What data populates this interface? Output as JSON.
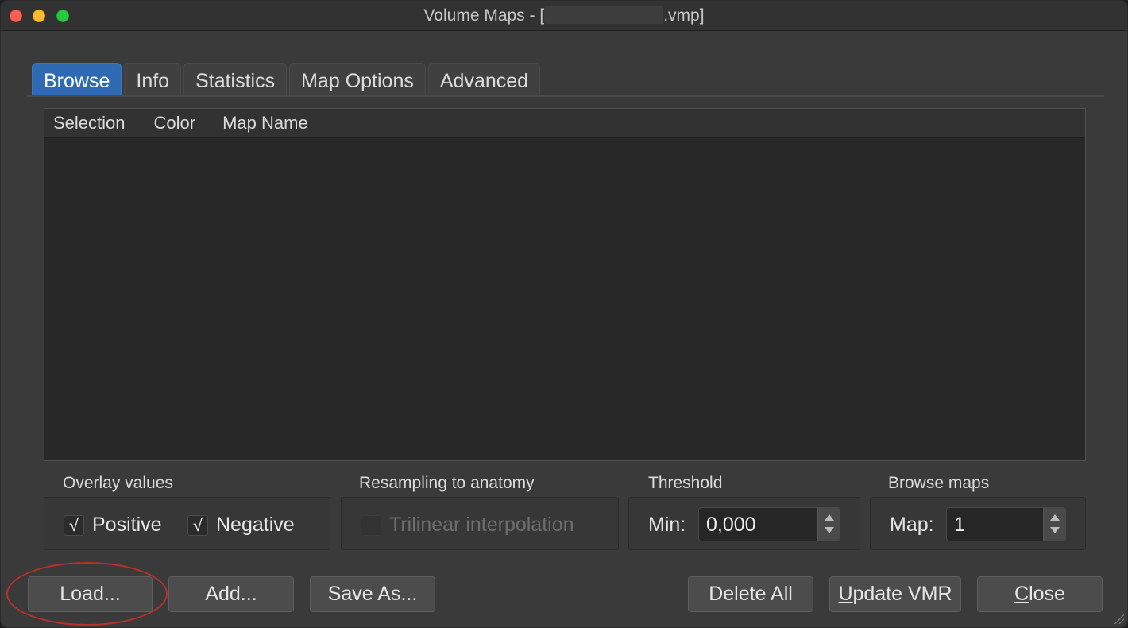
{
  "window": {
    "title_prefix": "Volume Maps - [",
    "title_suffix": ".vmp]"
  },
  "tabs": [
    {
      "label": "Browse",
      "active": true
    },
    {
      "label": "Info",
      "active": false
    },
    {
      "label": "Statistics",
      "active": false
    },
    {
      "label": "Map Options",
      "active": false
    },
    {
      "label": "Advanced",
      "active": false
    }
  ],
  "table": {
    "columns": [
      "Selection",
      "Color",
      "Map Name"
    ],
    "rows": []
  },
  "overlay": {
    "label": "Overlay values",
    "positive": {
      "label": "Positive",
      "checked": true
    },
    "negative": {
      "label": "Negative",
      "checked": true
    }
  },
  "resampling": {
    "label": "Resampling to anatomy",
    "trilinear": {
      "label": "Trilinear interpolation",
      "checked": false,
      "enabled": false
    }
  },
  "threshold": {
    "label": "Threshold",
    "min_label": "Min:",
    "min_value": "0,000"
  },
  "browse_maps": {
    "label": "Browse maps",
    "map_label": "Map:",
    "map_value": "1"
  },
  "buttons": {
    "load": "Load...",
    "add": "Add...",
    "save_as": "Save As...",
    "delete_all": "Delete All",
    "update_vmr_u": "U",
    "update_vmr_rest": "pdate VMR",
    "close_u": "C",
    "close_rest": "lose"
  },
  "check_glyph": "√",
  "colors": {
    "accent": "#2f6bb3",
    "annotation": "#b8302a"
  }
}
